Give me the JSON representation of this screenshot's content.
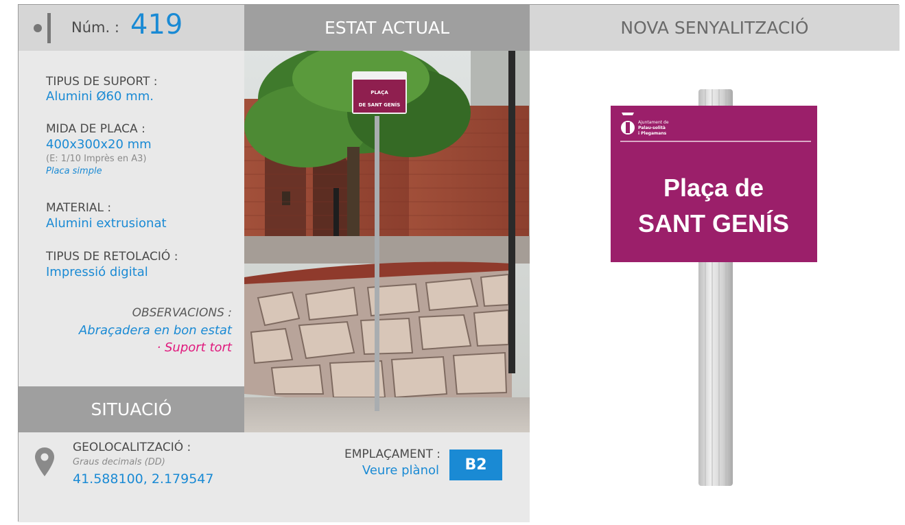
{
  "header": {
    "num_label": "Núm. :",
    "num_value": "419",
    "estat_actual": "ESTAT ACTUAL",
    "nova_senyalitzacio": "NOVA SENYALITZACIÓ"
  },
  "specs": {
    "tipus_suport_label": "TIPUS DE SUPORT :",
    "tipus_suport_value": "Alumini Ø60 mm.",
    "mida_placa_label": "MIDA DE PLACA :",
    "mida_placa_value": "400x300x20 mm",
    "mida_placa_scale": "(E: 1/10 Imprès en A3)",
    "mida_placa_type": "Placa simple",
    "material_label": "MATERIAL :",
    "material_value": "Alumini extrusionat",
    "retolacio_label": "TIPUS DE RETOLACIÓ :",
    "retolacio_value": "Impressió digital",
    "observacions_label": "OBSERVACIONS :",
    "observacions_line1": "Abraçadera en bon estat",
    "observacions_line2": "· Suport tort"
  },
  "situacio": {
    "title": "SITUACIÓ",
    "geo_label": "GEOLOCALITZACIÓ :",
    "geo_format": "Graus decimals (DD)",
    "geo_value": "41.588100, 2.179547",
    "emplacament_label": "EMPLAÇAMENT :",
    "emplacament_link": "Veure plànol",
    "emplacament_code": "B2"
  },
  "photo_sign": {
    "line1": "PLAÇA",
    "line2": "DE SANT GENÍS"
  },
  "new_sign": {
    "org_line1": "Ajuntament de",
    "org_line2": "Palau-solità",
    "org_line3": "i Plegamans",
    "title_line1": "Plaça de",
    "title_line2": "SANT GENÍS"
  },
  "colors": {
    "accent_blue": "#1a8ad4",
    "magenta": "#e0197d",
    "sign_purple": "#9b1f6a",
    "header_dark": "#9f9f9f",
    "header_light": "#d6d6d6",
    "panel": "#e9e9e9"
  },
  "icons": [
    "location-pin-icon",
    "bullet-icon",
    "municipal-logo-icon"
  ]
}
